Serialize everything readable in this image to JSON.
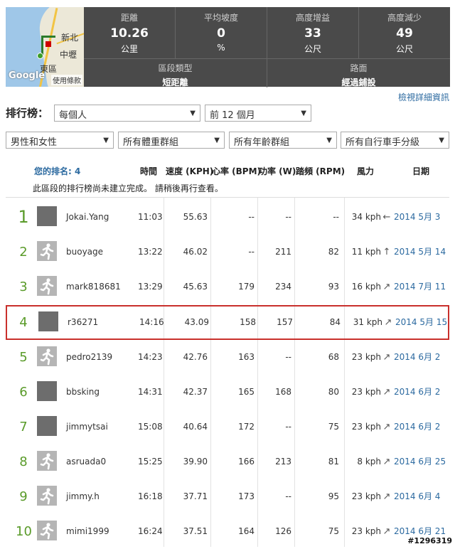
{
  "map": {
    "labels": [
      "新北",
      "中壢",
      "東區"
    ],
    "google": "Google",
    "terms": "使用條款"
  },
  "stats": [
    {
      "label": "距離",
      "value": "10.26",
      "unit": "公里"
    },
    {
      "label": "平均坡度",
      "value": "0",
      "unit": "%"
    },
    {
      "label": "高度增益",
      "value": "33",
      "unit": "公尺"
    },
    {
      "label": "高度減少",
      "value": "49",
      "unit": "公尺"
    }
  ],
  "segment": {
    "type_label": "區段類型",
    "type_value": "短距離",
    "surface_label": "路面",
    "surface_value": "經過鋪設"
  },
  "details_link": "檢視詳細資訊",
  "leaderboard": {
    "title": "排行榜：",
    "filter_people": "每個人",
    "filter_period": "前 12 個月",
    "filter_gender": "男性和女性",
    "filter_weight": "所有體重群組",
    "filter_age": "所有年齡群組",
    "filter_class": "所有自行車手分級"
  },
  "headers": {
    "rank": "您的排名: 4",
    "time": "時間",
    "speed": "速度 (KPH)",
    "hr": "心率 (BPM)",
    "power": "功率 (W)",
    "cadence": "踏頻 (RPM)",
    "wind": "風力",
    "date": "日期"
  },
  "notice": "此區段的排行榜尚未建立完成。 請稍後再行查看。",
  "rows": [
    {
      "rank": "1",
      "name": "Jokai.Yang",
      "time": "11:03",
      "speed": "55.63",
      "hr": "--",
      "power": "--",
      "cadence": "--",
      "wind": "34 kph",
      "wind_dir": "←",
      "date": "2014 5月 3",
      "avatar": "photo"
    },
    {
      "rank": "2",
      "name": "buoyage",
      "time": "13:22",
      "speed": "46.02",
      "hr": "--",
      "power": "211",
      "cadence": "82",
      "wind": "11 kph",
      "wind_dir": "↑",
      "date": "2014 5月 14",
      "avatar": "default"
    },
    {
      "rank": "3",
      "name": "mark818681",
      "time": "13:29",
      "speed": "45.63",
      "hr": "179",
      "power": "234",
      "cadence": "93",
      "wind": "16 kph",
      "wind_dir": "↗",
      "date": "2014 7月 11",
      "avatar": "default"
    },
    {
      "rank": "4",
      "name": "r36271",
      "time": "14:16",
      "speed": "43.09",
      "hr": "158",
      "power": "157",
      "cadence": "84",
      "wind": "31 kph",
      "wind_dir": "↗",
      "date": "2014 5月 15",
      "avatar": "photo"
    },
    {
      "rank": "5",
      "name": "pedro2139",
      "time": "14:23",
      "speed": "42.76",
      "hr": "163",
      "power": "--",
      "cadence": "68",
      "wind": "23 kph",
      "wind_dir": "↗",
      "date": "2014 6月 2",
      "avatar": "default"
    },
    {
      "rank": "6",
      "name": "bbsking",
      "time": "14:31",
      "speed": "42.37",
      "hr": "165",
      "power": "168",
      "cadence": "80",
      "wind": "23 kph",
      "wind_dir": "↗",
      "date": "2014 6月 2",
      "avatar": "photo"
    },
    {
      "rank": "7",
      "name": "jimmytsai",
      "time": "15:08",
      "speed": "40.64",
      "hr": "172",
      "power": "--",
      "cadence": "75",
      "wind": "23 kph",
      "wind_dir": "↗",
      "date": "2014 6月 2",
      "avatar": "photo"
    },
    {
      "rank": "8",
      "name": "asruada0",
      "time": "15:25",
      "speed": "39.90",
      "hr": "166",
      "power": "213",
      "cadence": "81",
      "wind": "8 kph",
      "wind_dir": "↗",
      "date": "2014 6月 25",
      "avatar": "default"
    },
    {
      "rank": "9",
      "name": "jimmy.h",
      "time": "16:18",
      "speed": "37.71",
      "hr": "173",
      "power": "--",
      "cadence": "95",
      "wind": "23 kph",
      "wind_dir": "↗",
      "date": "2014 6月 4",
      "avatar": "default"
    },
    {
      "rank": "10",
      "name": "mimi1999",
      "time": "16:24",
      "speed": "37.51",
      "hr": "164",
      "power": "126",
      "cadence": "75",
      "wind": "23 kph",
      "wind_dir": "↗",
      "date": "2014 6月 21",
      "avatar": "default"
    }
  ],
  "watermark": "#1296319"
}
